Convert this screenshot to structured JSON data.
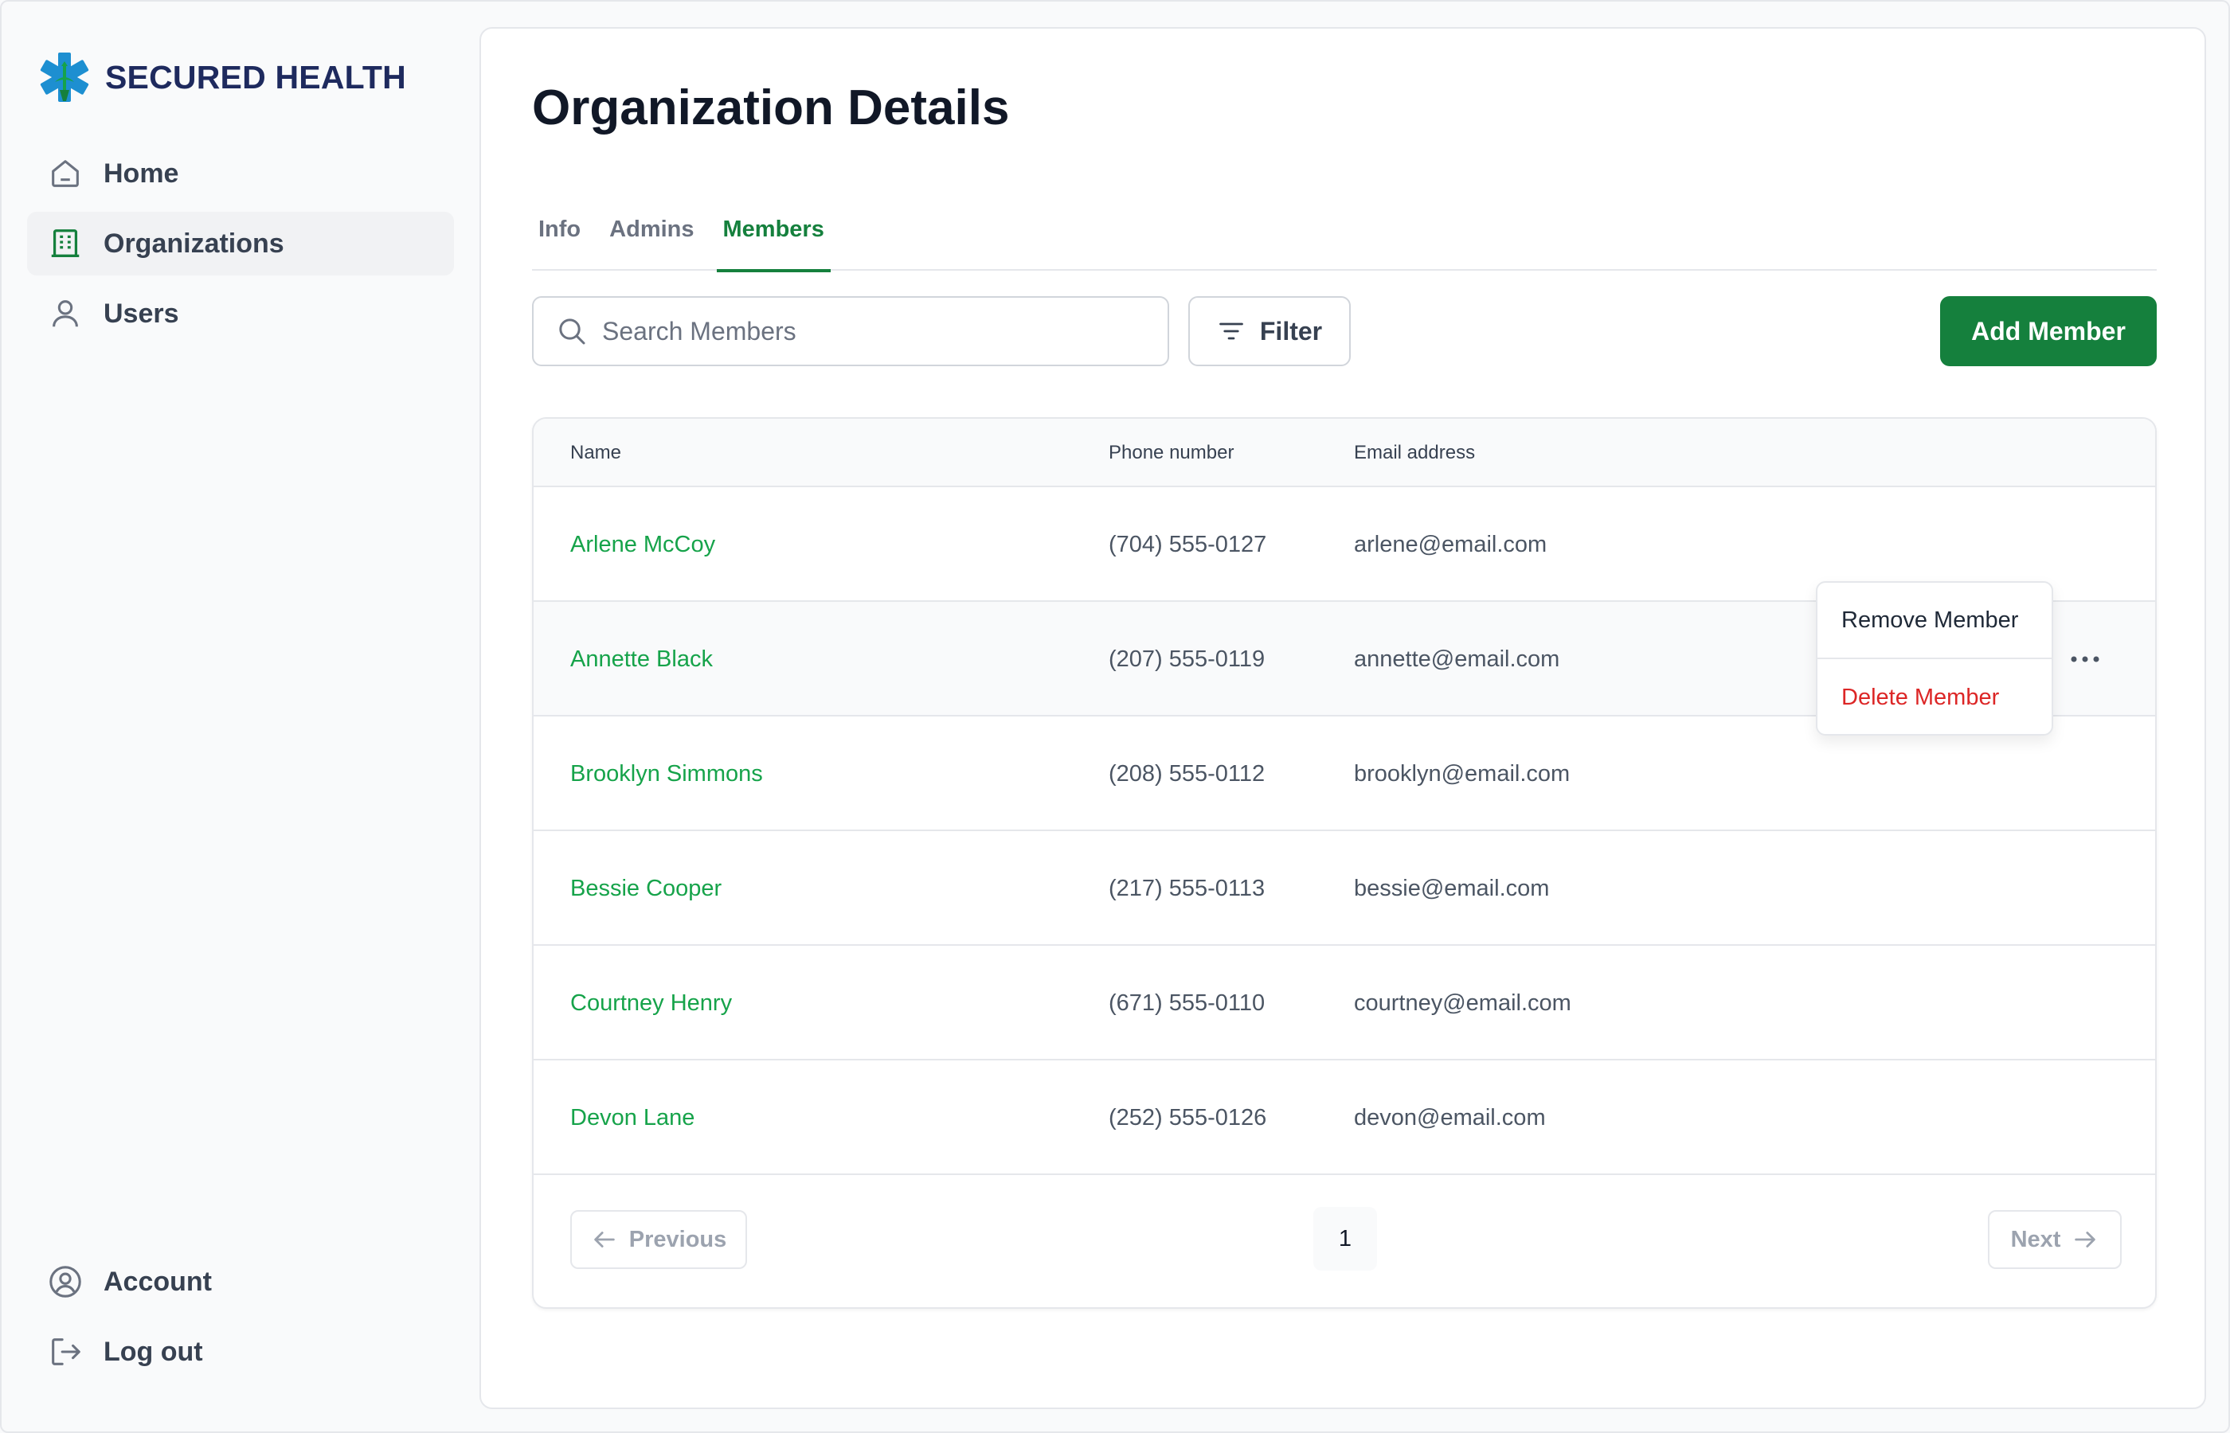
{
  "brand": {
    "name": "SECURED HEALTH"
  },
  "sidebar": {
    "items": [
      {
        "label": "Home",
        "icon": "home-icon"
      },
      {
        "label": "Organizations",
        "icon": "building-icon",
        "active": true
      },
      {
        "label": "Users",
        "icon": "user-icon"
      }
    ],
    "bottom_items": [
      {
        "label": "Account",
        "icon": "account-circle-icon"
      },
      {
        "label": "Log out",
        "icon": "logout-icon"
      }
    ]
  },
  "page": {
    "title": "Organization Details"
  },
  "tabs": [
    {
      "label": "Info"
    },
    {
      "label": "Admins"
    },
    {
      "label": "Members",
      "active": true
    }
  ],
  "toolbar": {
    "search_placeholder": "Search Members",
    "filter_label": "Filter",
    "add_label": "Add Member"
  },
  "table": {
    "columns": [
      "Name",
      "Phone number",
      "Email address"
    ],
    "rows": [
      {
        "name": "Arlene McCoy",
        "phone": "(704) 555-0127",
        "email": "arlene@email.com"
      },
      {
        "name": "Annette Black",
        "phone": "(207) 555-0119",
        "email": "annette@email.com"
      },
      {
        "name": "Brooklyn Simmons",
        "phone": "(208) 555-0112",
        "email": "brooklyn@email.com"
      },
      {
        "name": "Bessie Cooper",
        "phone": "(217) 555-0113",
        "email": "bessie@email.com"
      },
      {
        "name": "Courtney Henry",
        "phone": "(671) 555-0110",
        "email": "courtney@email.com"
      },
      {
        "name": "Devon Lane",
        "phone": "(252) 555-0126",
        "email": "devon@email.com"
      }
    ]
  },
  "context_menu": {
    "items": [
      {
        "label": "Remove Member"
      },
      {
        "label": "Delete Member"
      }
    ]
  },
  "pagination": {
    "previous_label": "Previous",
    "next_label": "Next",
    "current_page": "1"
  },
  "colors": {
    "accent": "#15803d",
    "link": "#16a34a",
    "danger": "#dc2626",
    "brand_text": "#1e2a5e"
  }
}
